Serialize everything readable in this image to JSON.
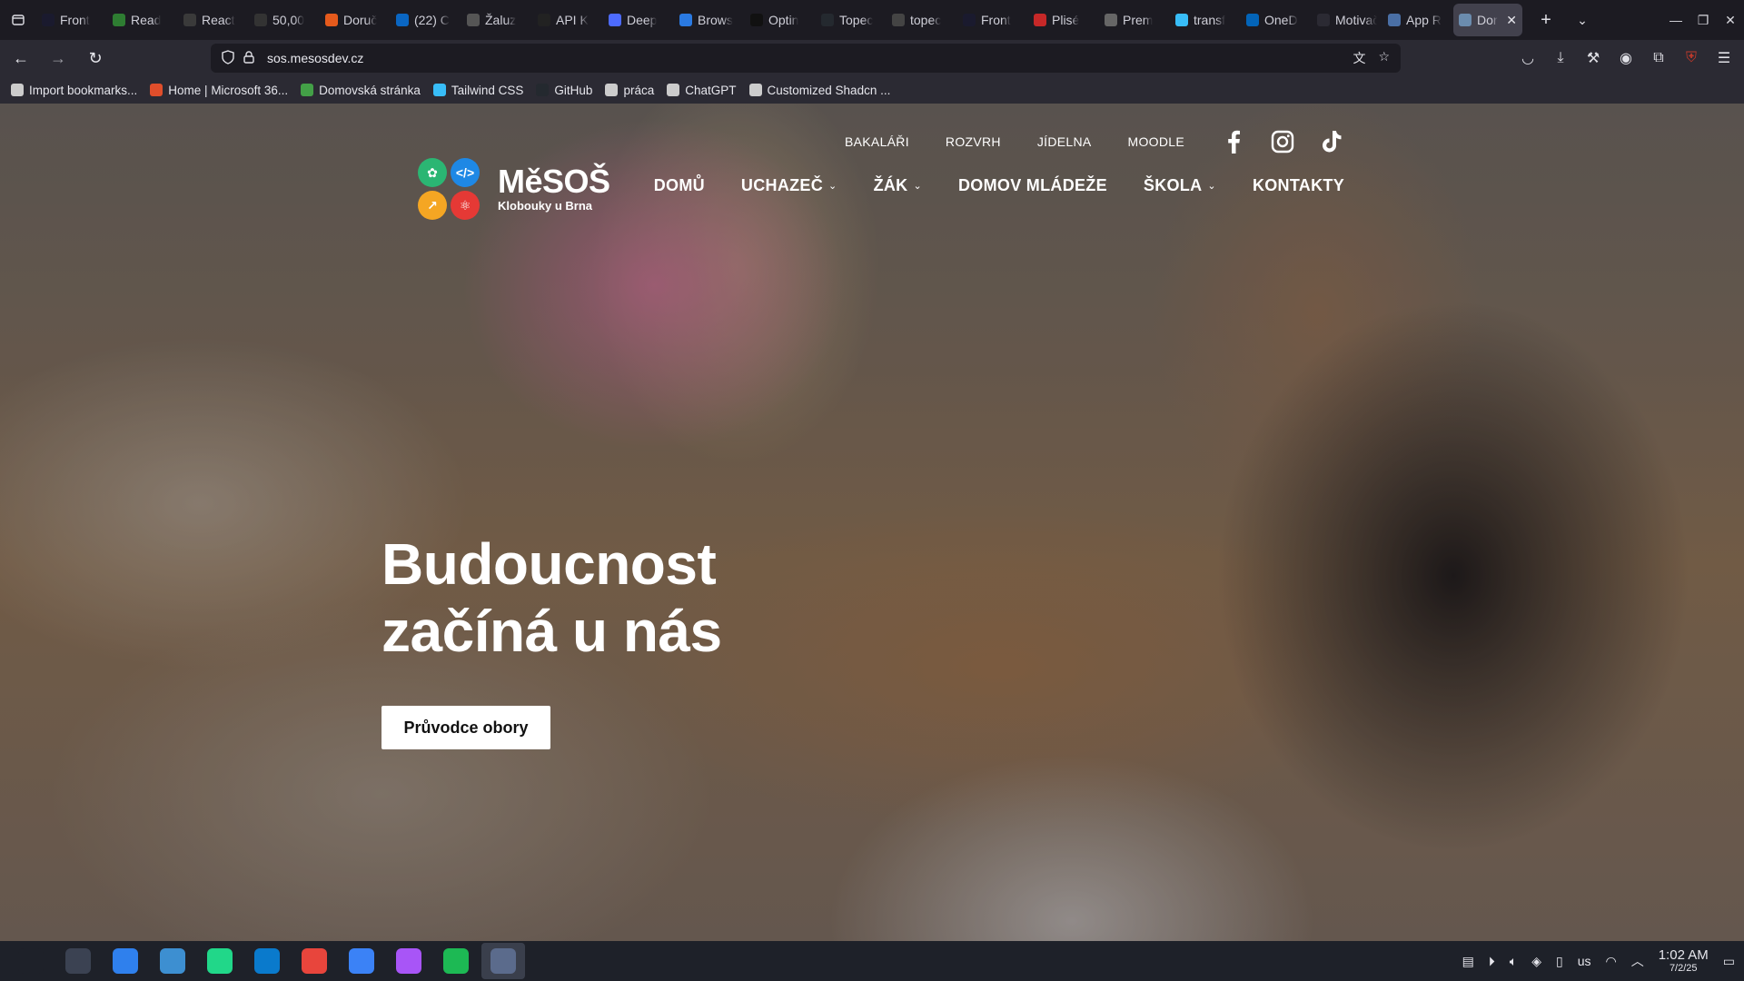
{
  "browser": {
    "tabs": [
      {
        "label": "Front",
        "color": "#1a1a2e"
      },
      {
        "label": "Read",
        "color": "#2e7d32"
      },
      {
        "label": "React",
        "color": "#3a3a3a"
      },
      {
        "label": "50,00",
        "color": "#333333"
      },
      {
        "label": "Doruč",
        "color": "#e55a1c"
      },
      {
        "label": "(22) C",
        "color": "#0a66c2"
      },
      {
        "label": "Žaluz",
        "color": "#555555"
      },
      {
        "label": "API K",
        "color": "#222222"
      },
      {
        "label": "Deep",
        "color": "#4d6bfe"
      },
      {
        "label": "Brows",
        "color": "#2a7ae2"
      },
      {
        "label": "Optin",
        "color": "#111111"
      },
      {
        "label": "Topec",
        "color": "#24292f"
      },
      {
        "label": "topec",
        "color": "#444444"
      },
      {
        "label": "Front",
        "color": "#1a1a2e"
      },
      {
        "label": "Plisé",
        "color": "#c62828"
      },
      {
        "label": "Prem",
        "color": "#666666"
      },
      {
        "label": "transf",
        "color": "#38bdf8"
      },
      {
        "label": "OneD",
        "color": "#0364b8"
      },
      {
        "label": "Motivačn",
        "color": "#2b2a33"
      },
      {
        "label": "App R",
        "color": "#4a6fa5"
      },
      {
        "label": "Dor",
        "color": "#6b8cae",
        "active": true
      }
    ],
    "url": "sos.mesosdev.cz",
    "bookmarks": [
      {
        "label": "Import bookmarks...",
        "color": "#cccccc"
      },
      {
        "label": "Home | Microsoft 36...",
        "color": "#e04e2b"
      },
      {
        "label": "Domovská stránka",
        "color": "#43a047"
      },
      {
        "label": "Tailwind CSS",
        "color": "#38bdf8"
      },
      {
        "label": "GitHub",
        "color": "#24292f"
      },
      {
        "label": "práca",
        "color": "#cccccc"
      },
      {
        "label": "ChatGPT",
        "color": "#cccccc"
      },
      {
        "label": "Customized Shadcn ...",
        "color": "#cccccc"
      }
    ]
  },
  "site": {
    "logo": {
      "title": "MěSOŠ",
      "subtitle": "Klobouky u Brna"
    },
    "top_links": [
      "BAKALÁŘI",
      "ROZVRH",
      "JÍDELNA",
      "MOODLE"
    ],
    "social": [
      "facebook-icon",
      "instagram-icon",
      "tiktok-icon"
    ],
    "nav": [
      {
        "label": "DOMŮ",
        "dropdown": false
      },
      {
        "label": "UCHAZEČ",
        "dropdown": true
      },
      {
        "label": "ŽÁK",
        "dropdown": true
      },
      {
        "label": "DOMOV MLÁDEŽE",
        "dropdown": false
      },
      {
        "label": "ŠKOLA",
        "dropdown": true
      },
      {
        "label": "KONTAKTY",
        "dropdown": false
      }
    ],
    "hero": {
      "line1": "Budoucnost",
      "line2": "začíná u nás",
      "cta": "Průvodce obory"
    }
  },
  "taskbar": {
    "apps": [
      {
        "name": "launcher",
        "color": "#1e2129"
      },
      {
        "name": "system-settings",
        "color": "#3b4252"
      },
      {
        "name": "store",
        "color": "#2f80ed"
      },
      {
        "name": "files",
        "color": "#3d8fd1"
      },
      {
        "name": "clion",
        "color": "#21d789"
      },
      {
        "name": "vscode",
        "color": "#0a7acc"
      },
      {
        "name": "chrome",
        "color": "#e8453c"
      },
      {
        "name": "firefox",
        "color": "#3b82f6"
      },
      {
        "name": "image-viewer",
        "color": "#a855f7"
      },
      {
        "name": "spotify",
        "color": "#1db954"
      },
      {
        "name": "screenshot",
        "color": "#5b6b8c",
        "active": true
      }
    ],
    "keyboard_layout": "us",
    "time": "1:02 AM",
    "date": "7/2/25"
  }
}
